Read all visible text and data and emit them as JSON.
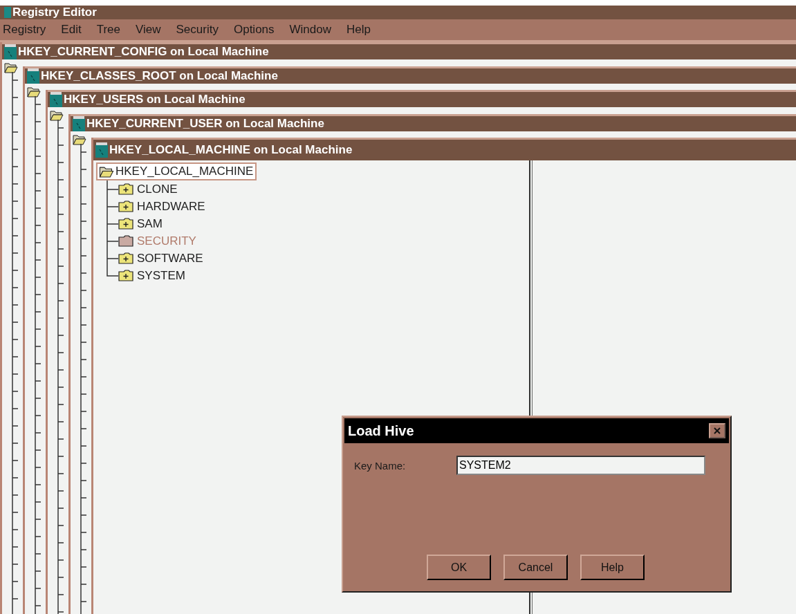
{
  "app": {
    "title": "Registry Editor"
  },
  "menu": [
    "Registry",
    "Edit",
    "Tree",
    "View",
    "Security",
    "Options",
    "Window",
    "Help"
  ],
  "windows": [
    {
      "title": "HKEY_CURRENT_CONFIG on Local Machine"
    },
    {
      "title": "HKEY_CLASSES_ROOT on Local Machine"
    },
    {
      "title": "HKEY_USERS on Local Machine"
    },
    {
      "title": "HKEY_CURRENT_USER on Local Machine"
    },
    {
      "title": "HKEY_LOCAL_MACHINE on Local Machine"
    }
  ],
  "tree": {
    "label": "HKEY_LOCAL_MACHINE",
    "selected": true,
    "children": [
      {
        "label": "CLONE",
        "disabled": false
      },
      {
        "label": "HARDWARE",
        "disabled": false
      },
      {
        "label": "SAM",
        "disabled": false
      },
      {
        "label": "SECURITY",
        "disabled": true
      },
      {
        "label": "SOFTWARE",
        "disabled": false
      },
      {
        "label": "SYSTEM",
        "disabled": false
      }
    ]
  },
  "dialog": {
    "title": "Load Hive",
    "field_label": "Key Name:",
    "value": "SYSTEM2",
    "buttons": [
      "OK",
      "Cancel",
      "Help"
    ]
  }
}
